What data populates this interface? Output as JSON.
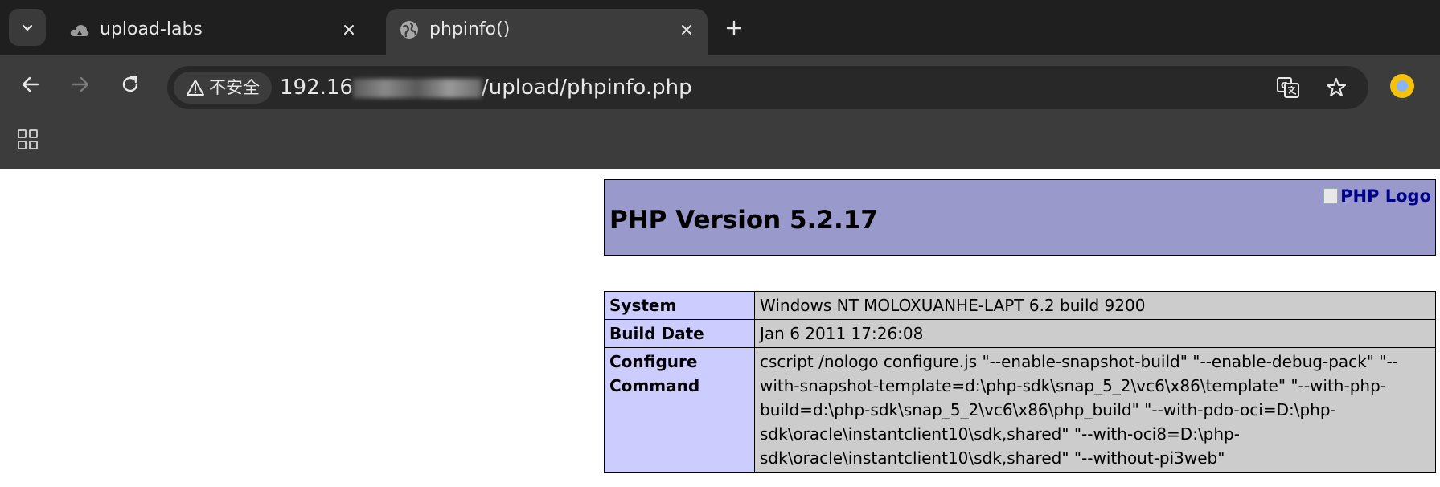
{
  "tabs": [
    {
      "title": "upload-labs",
      "favicon": "cloud-icon",
      "active": false
    },
    {
      "title": "phpinfo()",
      "favicon": "globe-icon",
      "active": true
    }
  ],
  "toolbar": {
    "security_label": "不安全",
    "url_prefix": "192.16",
    "url_suffix": "/upload/phpinfo.php"
  },
  "page": {
    "php_version": "PHP Version 5.2.17",
    "logo_alt": "PHP Logo",
    "rows": [
      {
        "key": "System",
        "value": "Windows NT MOLOXUANHE-LAPT 6.2 build 9200"
      },
      {
        "key": "Build Date",
        "value": "Jan 6 2011 17:26:08"
      },
      {
        "key": "Configure Command",
        "value": "cscript /nologo configure.js \"--enable-snapshot-build\" \"--enable-debug-pack\" \"--with-snapshot-template=d:\\php-sdk\\snap_5_2\\vc6\\x86\\template\" \"--with-php-build=d:\\php-sdk\\snap_5_2\\vc6\\x86\\php_build\" \"--with-pdo-oci=D:\\php-sdk\\oracle\\instantclient10\\sdk,shared\" \"--with-oci8=D:\\php-sdk\\oracle\\instantclient10\\sdk,shared\" \"--without-pi3web\""
      }
    ]
  },
  "colors": {
    "header_bg": "#9999cc",
    "key_bg": "#ccccff",
    "value_bg": "#cccccc",
    "chrome_dark": "#1f1f1f",
    "chrome_toolbar": "#3c3c3c"
  }
}
